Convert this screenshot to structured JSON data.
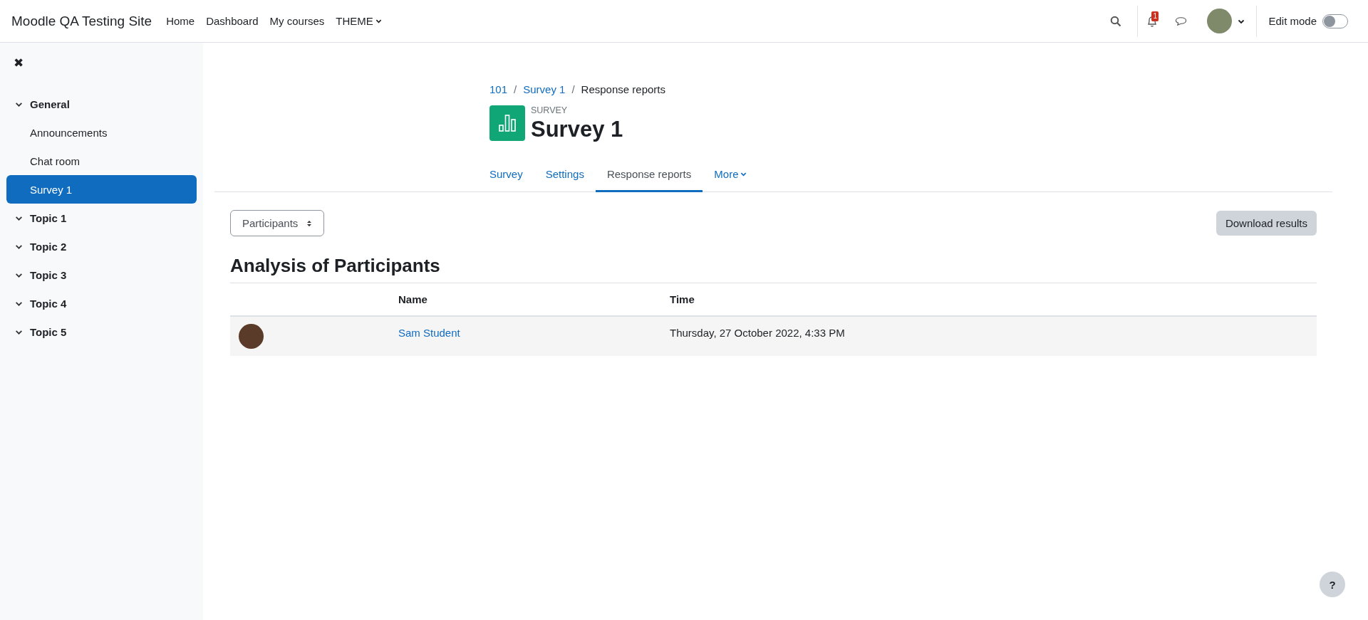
{
  "navbar": {
    "site_name": "Moodle QA Testing Site",
    "links": [
      {
        "label": "Home",
        "dropdown": false
      },
      {
        "label": "Dashboard",
        "dropdown": false
      },
      {
        "label": "My courses",
        "dropdown": false
      },
      {
        "label": "THEME",
        "dropdown": true
      }
    ],
    "notification_count": "1",
    "edit_mode": {
      "label": "Edit mode",
      "on": false
    }
  },
  "sidebar": {
    "close_icon": "✖",
    "items": [
      {
        "label": "General",
        "kind": "section",
        "expanded": true,
        "selected": false
      },
      {
        "label": "Announcements",
        "kind": "activity",
        "selected": false
      },
      {
        "label": "Chat room",
        "kind": "activity",
        "selected": false
      },
      {
        "label": "Survey 1",
        "kind": "activity",
        "selected": true
      },
      {
        "label": "Topic 1",
        "kind": "section",
        "expanded": true,
        "selected": false
      },
      {
        "label": "Topic 2",
        "kind": "section",
        "expanded": true,
        "selected": false
      },
      {
        "label": "Topic 3",
        "kind": "section",
        "expanded": true,
        "selected": false
      },
      {
        "label": "Topic 4",
        "kind": "section",
        "expanded": true,
        "selected": false
      },
      {
        "label": "Topic 5",
        "kind": "section",
        "expanded": true,
        "selected": false
      }
    ]
  },
  "breadcrumb": [
    {
      "label": "101",
      "link": true
    },
    {
      "separator": "/",
      "label": "Survey 1",
      "link": true
    },
    {
      "separator": "/",
      "label": "Response reports",
      "link": false
    }
  ],
  "header": {
    "module_label": "SURVEY",
    "title": "Survey 1"
  },
  "tabs": [
    {
      "label": "Survey",
      "selected": false,
      "dropdown": false
    },
    {
      "label": "Settings",
      "selected": false,
      "dropdown": false
    },
    {
      "label": "Response reports",
      "selected": true,
      "dropdown": false
    },
    {
      "label": "More",
      "selected": false,
      "dropdown": true
    }
  ],
  "report_select": {
    "value": "Participants"
  },
  "download_button": "Download results",
  "section_title": "Analysis of Participants",
  "table": {
    "columns": [
      "Name",
      "Time"
    ],
    "rows": [
      {
        "name": "Sam Student",
        "time": "Thursday, 27 October 2022, 4:33 PM"
      }
    ]
  },
  "help_button": "?"
}
